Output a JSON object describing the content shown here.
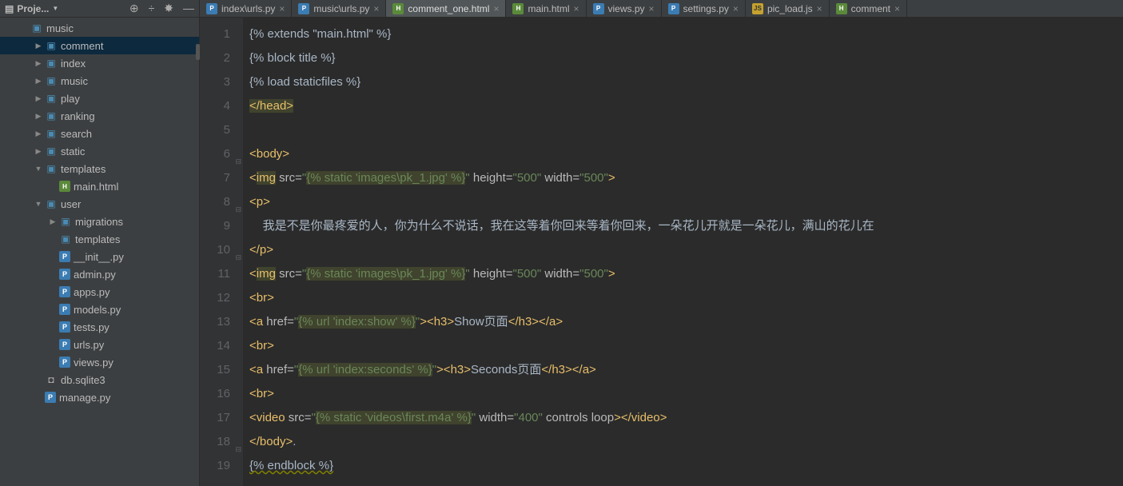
{
  "panel": {
    "title": "Proje..."
  },
  "tree": [
    {
      "depth": 0,
      "arrow": "none",
      "icon": "dir-mod",
      "label": "music",
      "selected": false
    },
    {
      "depth": 1,
      "arrow": "closed",
      "icon": "dir-mod",
      "label": "comment",
      "selected": true
    },
    {
      "depth": 1,
      "arrow": "closed",
      "icon": "dir-mod",
      "label": "index"
    },
    {
      "depth": 1,
      "arrow": "closed",
      "icon": "dir-mod",
      "label": "music"
    },
    {
      "depth": 1,
      "arrow": "closed",
      "icon": "dir-mod",
      "label": "play"
    },
    {
      "depth": 1,
      "arrow": "closed",
      "icon": "dir-mod",
      "label": "ranking"
    },
    {
      "depth": 1,
      "arrow": "closed",
      "icon": "dir-mod",
      "label": "search"
    },
    {
      "depth": 1,
      "arrow": "closed",
      "icon": "dir-mod",
      "label": "static"
    },
    {
      "depth": 1,
      "arrow": "open",
      "icon": "dir-mod",
      "label": "templates"
    },
    {
      "depth": 2,
      "arrow": "none",
      "icon": "html",
      "label": "main.html"
    },
    {
      "depth": 1,
      "arrow": "open",
      "icon": "dir-mod",
      "label": "user"
    },
    {
      "depth": 2,
      "arrow": "closed",
      "icon": "dir-mod",
      "label": "migrations"
    },
    {
      "depth": 2,
      "arrow": "none",
      "icon": "dir-mod",
      "label": "templates"
    },
    {
      "depth": 2,
      "arrow": "none",
      "icon": "py",
      "label": "__init__.py"
    },
    {
      "depth": 2,
      "arrow": "none",
      "icon": "py",
      "label": "admin.py"
    },
    {
      "depth": 2,
      "arrow": "none",
      "icon": "py",
      "label": "apps.py"
    },
    {
      "depth": 2,
      "arrow": "none",
      "icon": "py",
      "label": "models.py"
    },
    {
      "depth": 2,
      "arrow": "none",
      "icon": "py",
      "label": "tests.py"
    },
    {
      "depth": 2,
      "arrow": "none",
      "icon": "py",
      "label": "urls.py"
    },
    {
      "depth": 2,
      "arrow": "none",
      "icon": "py",
      "label": "views.py"
    },
    {
      "depth": 1,
      "arrow": "none",
      "icon": "db",
      "label": "db.sqlite3"
    },
    {
      "depth": 1,
      "arrow": "none",
      "icon": "py",
      "label": "manage.py"
    }
  ],
  "tabs": [
    {
      "icon": "py",
      "label": "index\\urls.py",
      "active": false
    },
    {
      "icon": "py",
      "label": "music\\urls.py",
      "active": false
    },
    {
      "icon": "html",
      "label": "comment_one.html",
      "active": true
    },
    {
      "icon": "html",
      "label": "main.html",
      "active": false
    },
    {
      "icon": "py",
      "label": "views.py",
      "active": false
    },
    {
      "icon": "py",
      "label": "settings.py",
      "active": false
    },
    {
      "icon": "js",
      "label": "pic_load.js",
      "active": false
    },
    {
      "icon": "html",
      "label": "comment",
      "active": false
    }
  ],
  "code": {
    "lines": [
      {
        "n": 1,
        "seg": [
          [
            "tpl",
            "{% extends \"main.html\" %}"
          ]
        ]
      },
      {
        "n": 2,
        "seg": [
          [
            "tpl",
            "{% block title %}"
          ]
        ]
      },
      {
        "n": 3,
        "seg": [
          [
            "tpl",
            "{% load staticfiles %}"
          ]
        ]
      },
      {
        "n": 4,
        "seg": [
          [
            "taghl",
            "</head>"
          ]
        ]
      },
      {
        "n": 5,
        "seg": [
          [
            "txt",
            ""
          ]
        ]
      },
      {
        "n": 6,
        "fold": "-",
        "seg": [
          [
            "tag",
            "<body>"
          ]
        ]
      },
      {
        "n": 7,
        "seg": [
          [
            "tag",
            "<"
          ],
          [
            "taghl",
            "img"
          ],
          [
            "txt",
            " "
          ],
          [
            "attr",
            "src="
          ],
          [
            "str",
            "\""
          ],
          [
            "strhl",
            "{% static 'images\\pk_1.jpg' %}"
          ],
          [
            "str",
            "\""
          ],
          [
            "txt",
            " "
          ],
          [
            "attr",
            "height="
          ],
          [
            "str",
            "\"500\""
          ],
          [
            "txt",
            " "
          ],
          [
            "attr",
            "width="
          ],
          [
            "str",
            "\"500\""
          ],
          [
            "tag",
            ">"
          ]
        ]
      },
      {
        "n": 8,
        "fold": "-",
        "seg": [
          [
            "tag",
            "<p>"
          ]
        ]
      },
      {
        "n": 9,
        "seg": [
          [
            "txt",
            "    我是不是你最疼爱的人，你为什么不说话，我在这等着你回来等着你回来，一朵花儿开就是一朵花儿，满山的花儿在"
          ]
        ]
      },
      {
        "n": 10,
        "fold": "-",
        "seg": [
          [
            "tag",
            "</p>"
          ]
        ]
      },
      {
        "n": 11,
        "seg": [
          [
            "tag",
            "<"
          ],
          [
            "taghl",
            "img"
          ],
          [
            "txt",
            " "
          ],
          [
            "attr",
            "src="
          ],
          [
            "str",
            "\""
          ],
          [
            "strhl",
            "{% static 'images\\pk_1.jpg' %}"
          ],
          [
            "str",
            "\""
          ],
          [
            "txt",
            " "
          ],
          [
            "attr",
            "height="
          ],
          [
            "str",
            "\"500\""
          ],
          [
            "txt",
            " "
          ],
          [
            "attr",
            "width="
          ],
          [
            "str",
            "\"500\""
          ],
          [
            "tag",
            ">"
          ]
        ]
      },
      {
        "n": 12,
        "seg": [
          [
            "tag",
            "<br>"
          ]
        ]
      },
      {
        "n": 13,
        "seg": [
          [
            "tag",
            "<a "
          ],
          [
            "attr",
            "href="
          ],
          [
            "str",
            "\""
          ],
          [
            "strhl",
            "{% url 'index:show' %}"
          ],
          [
            "str",
            "\""
          ],
          [
            "tag",
            "><h3>"
          ],
          [
            "txt",
            "Show页面"
          ],
          [
            "tag",
            "</h3></a>"
          ]
        ]
      },
      {
        "n": 14,
        "seg": [
          [
            "tag",
            "<br>"
          ]
        ]
      },
      {
        "n": 15,
        "seg": [
          [
            "tag",
            "<a "
          ],
          [
            "attr",
            "href="
          ],
          [
            "str",
            "\""
          ],
          [
            "strhl",
            "{% url 'index:seconds' %}"
          ],
          [
            "str",
            "\""
          ],
          [
            "tag",
            "><h3>"
          ],
          [
            "txt",
            "Seconds页面"
          ],
          [
            "tag",
            "</h3></a>"
          ]
        ]
      },
      {
        "n": 16,
        "seg": [
          [
            "tag",
            "<br>"
          ]
        ]
      },
      {
        "n": 17,
        "seg": [
          [
            "tag",
            "<video "
          ],
          [
            "attr",
            "src="
          ],
          [
            "str",
            "\""
          ],
          [
            "strhl",
            "{% static 'videos\\first.m4a' %}"
          ],
          [
            "str",
            "\""
          ],
          [
            "txt",
            " "
          ],
          [
            "attr",
            "width="
          ],
          [
            "str",
            "\"400\""
          ],
          [
            "txt",
            " "
          ],
          [
            "attr",
            "controls loop"
          ],
          [
            "tag",
            "></video>"
          ]
        ]
      },
      {
        "n": 18,
        "fold": "-",
        "seg": [
          [
            "tag",
            "</body>"
          ],
          [
            "txt",
            "."
          ]
        ]
      },
      {
        "n": 19,
        "seg": [
          [
            "tplw",
            "{% endblock %}"
          ]
        ]
      }
    ]
  }
}
